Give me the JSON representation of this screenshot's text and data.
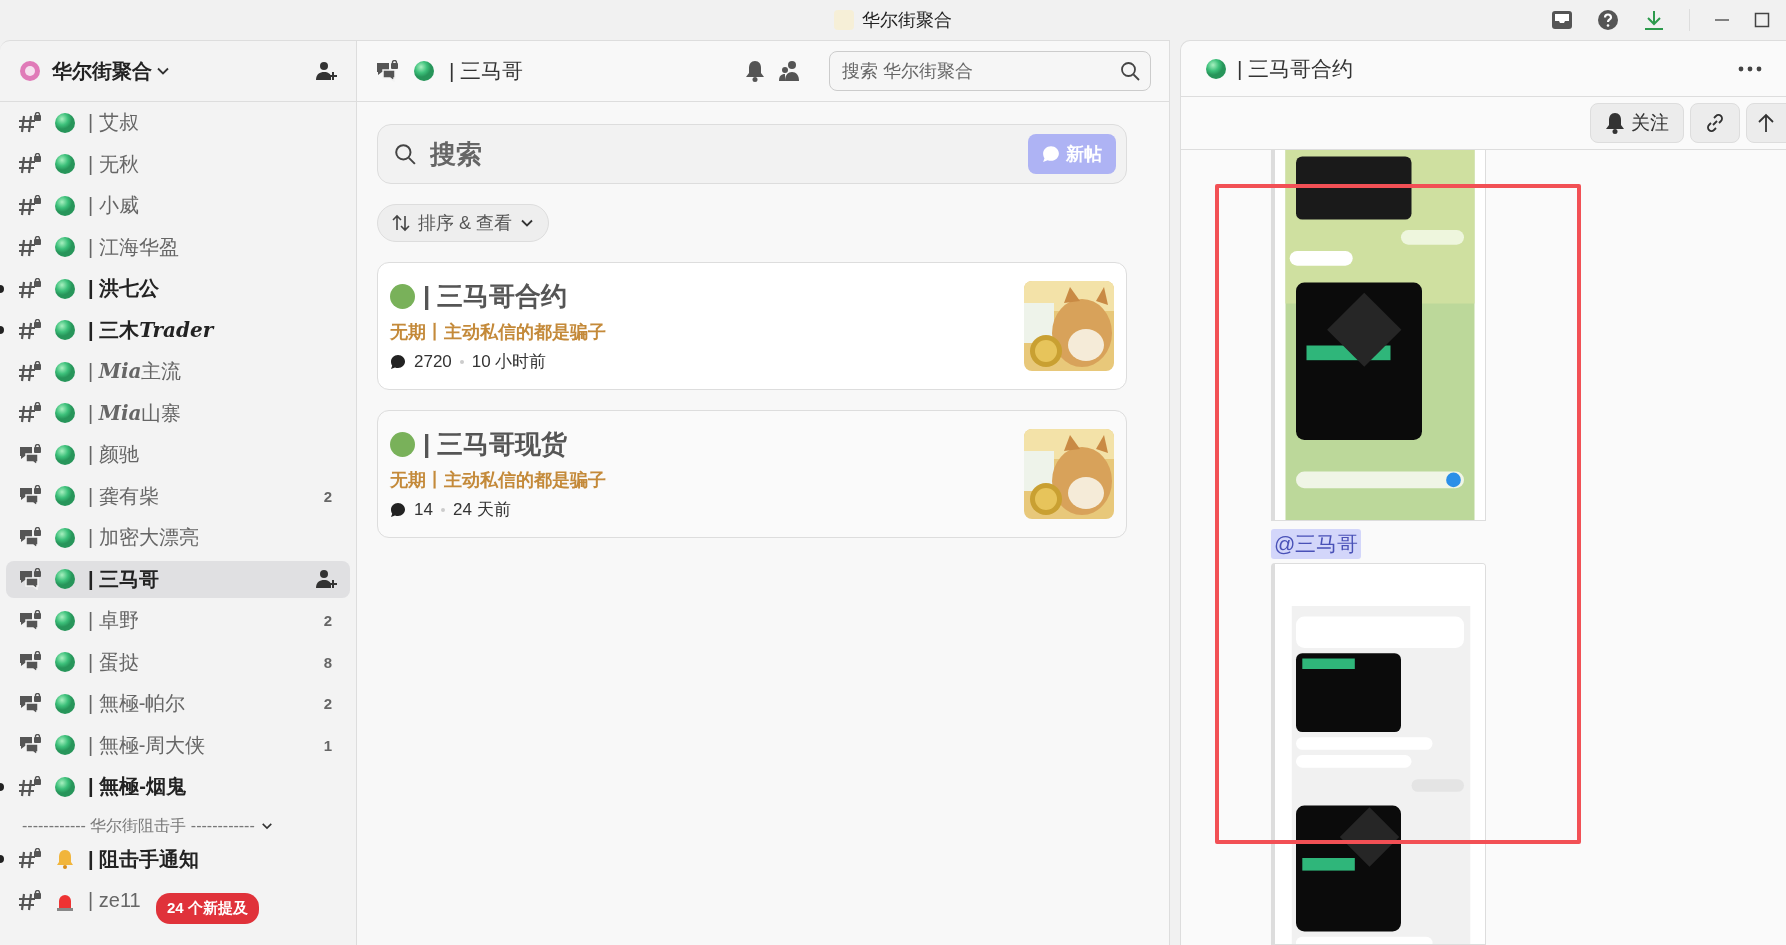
{
  "window": {
    "title": "华尔街聚合"
  },
  "sidebar": {
    "server": "华尔街聚合",
    "items": [
      {
        "kind": "channel",
        "emblem": {
          "kind": "orb"
        },
        "name": "| 艾叔",
        "unread": false,
        "selected": false
      },
      {
        "kind": "channel",
        "emblem": {
          "kind": "orb"
        },
        "name": "| 无秋",
        "unread": false,
        "selected": false
      },
      {
        "kind": "channel",
        "emblem": {
          "kind": "orb"
        },
        "name": "| 小威",
        "unread": false,
        "selected": false
      },
      {
        "kind": "channel",
        "emblem": {
          "kind": "orb"
        },
        "name": "| 江海华盈",
        "unread": false,
        "selected": false
      },
      {
        "kind": "channel",
        "emblem": {
          "kind": "orb"
        },
        "name": "| 洪七公",
        "unread": true,
        "selected": false
      },
      {
        "kind": "channel",
        "emblem": {
          "kind": "orb"
        },
        "name_parts": [
          {
            "text": "| 三木",
            "italic": false
          },
          {
            "text": "Trader",
            "italic": true
          }
        ],
        "unread": true,
        "selected": false
      },
      {
        "kind": "channel",
        "emblem": {
          "kind": "orb"
        },
        "name_parts": [
          {
            "text": "| ",
            "italic": false
          },
          {
            "text": "Mia",
            "italic": true
          },
          {
            "text": "主流",
            "italic": false
          }
        ],
        "unread": false,
        "selected": false
      },
      {
        "kind": "channel",
        "emblem": {
          "kind": "orb"
        },
        "name_parts": [
          {
            "text": "| ",
            "italic": false
          },
          {
            "text": "Mia",
            "italic": true
          },
          {
            "text": "山寨",
            "italic": false
          }
        ],
        "unread": false,
        "selected": false
      },
      {
        "kind": "forum",
        "emblem": {
          "kind": "orb"
        },
        "name": "| 颜驰",
        "unread": false,
        "selected": false
      },
      {
        "kind": "forum",
        "emblem": {
          "kind": "orb"
        },
        "name": "| 龚有柴",
        "unread": false,
        "selected": false,
        "count": "2"
      },
      {
        "kind": "forum",
        "emblem": {
          "kind": "orb"
        },
        "name": "| 加密大漂亮",
        "unread": false,
        "selected": false
      },
      {
        "kind": "forum",
        "emblem": {
          "kind": "orb"
        },
        "name": "| 三马哥",
        "unread": false,
        "selected": true
      },
      {
        "kind": "forum",
        "emblem": {
          "kind": "orb"
        },
        "name": "| 卓野",
        "unread": false,
        "selected": false,
        "count": "2"
      },
      {
        "kind": "forum",
        "emblem": {
          "kind": "orb"
        },
        "name": "| 蛋挞",
        "unread": false,
        "selected": false,
        "count": "8"
      },
      {
        "kind": "forum",
        "emblem": {
          "kind": "orb"
        },
        "name": "| 無極-帕尔",
        "unread": false,
        "selected": false,
        "count": "2"
      },
      {
        "kind": "forum",
        "emblem": {
          "kind": "orb"
        },
        "name": "| 無極-周大侠",
        "unread": false,
        "selected": false,
        "count": "1"
      },
      {
        "kind": "channel",
        "emblem": {
          "kind": "orb"
        },
        "name": "| 無極-烟鬼",
        "unread": true,
        "selected": false
      }
    ],
    "category": {
      "label": "------------ 华尔街阻击手 ------------",
      "expanded": true
    },
    "category_items": [
      {
        "kind": "channel",
        "emblem": {
          "kind": "bell"
        },
        "name": "| 阻击手通知",
        "unread": true,
        "selected": false
      },
      {
        "kind": "channel",
        "emblem": {
          "kind": "siren"
        },
        "name": "| ze11",
        "unread": false,
        "selected": false
      }
    ],
    "mentions_badge": "24 个新提及"
  },
  "forum": {
    "title": "| 三马哥",
    "search_placeholder": "搜索 华尔街聚合",
    "post_search_placeholder": "搜索",
    "new_post": "新帖",
    "sort": "排序 & 查看",
    "posts": [
      {
        "title": "| 三马哥合约",
        "color": "#79b15a",
        "tag": "无期丨主动私信的都是骗子",
        "replies": "2720",
        "time": "10 小时前"
      },
      {
        "title": "| 三马哥现货",
        "color": "#79b15a",
        "tag": "无期丨主动私信的都是骗子",
        "replies": "14",
        "time": "24 天前"
      }
    ]
  },
  "thread": {
    "title": "| 三马哥合约",
    "follow": "关注",
    "mention": "@三马哥"
  }
}
